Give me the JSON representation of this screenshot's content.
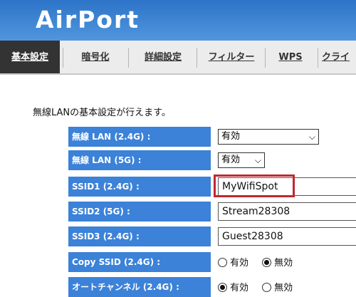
{
  "header": {
    "logo_text": "AirPort"
  },
  "tabs": [
    {
      "label": "基本設定"
    },
    {
      "label": "暗号化"
    },
    {
      "label": "詳細設定"
    },
    {
      "label": "フィルター"
    },
    {
      "label": "WPS"
    },
    {
      "label": "クライ"
    }
  ],
  "main": {
    "intro": "無線LANの基本設定が行えます。",
    "rows": [
      {
        "label": "無線 LAN (2.4G) :",
        "value": "有効",
        "control": "select"
      },
      {
        "label": "無線 LAN (5G) :",
        "value": "有効",
        "control": "select"
      },
      {
        "label": "SSID1 (2.4G) :",
        "value": "MyWifiSpot",
        "control": "text"
      },
      {
        "label": "SSID2 (5G) :",
        "value": "Stream28308",
        "control": "text"
      },
      {
        "label": "SSID3 (2.4G) :",
        "value": "Guest28308",
        "control": "text"
      },
      {
        "label": "Copy SSID (2.4G) :",
        "control": "radio",
        "options": [
          "有効",
          "無効"
        ],
        "selected": "無効"
      },
      {
        "label": "オートチャンネル (2.4G) :",
        "control": "radio",
        "options": [
          "有効",
          "無効"
        ],
        "selected": "有効"
      }
    ]
  },
  "icons": {
    "dropdown": "chevron-down-icon"
  },
  "colors": {
    "header_blue": "#3f85d6",
    "label_blue": "#3b82d8",
    "active_tab": "#333333",
    "highlight_red": "#c0282f"
  }
}
